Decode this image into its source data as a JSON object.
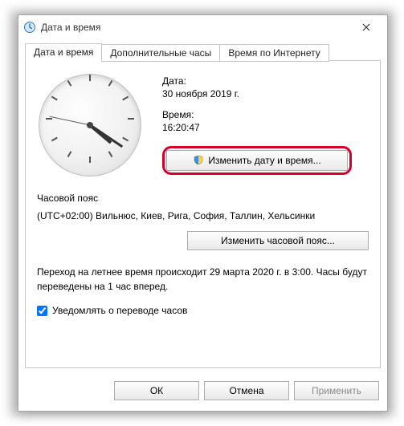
{
  "window": {
    "title": "Дата и время"
  },
  "tabs": [
    {
      "label": "Дата и время",
      "active": true
    },
    {
      "label": "Дополнительные часы",
      "active": false
    },
    {
      "label": "Время по Интернету",
      "active": false
    }
  ],
  "dateSection": {
    "dateLabel": "Дата:",
    "dateValue": "30 ноября 2019 г.",
    "timeLabel": "Время:",
    "timeValue": "16:20:47",
    "changeButton": "Изменить дату и время..."
  },
  "timezone": {
    "heading": "Часовой пояс",
    "value": "(UTC+02:00) Вильнюс, Киев, Рига, София, Таллин, Хельсинки",
    "changeButton": "Изменить часовой пояс..."
  },
  "dst": {
    "text": "Переход на летнее время происходит 29 марта 2020 г. в 3:00. Часы будут переведены на 1 час вперед.",
    "checkboxLabel": "Уведомлять о переводе часов",
    "checked": true
  },
  "footer": {
    "ok": "ОК",
    "cancel": "Отмена",
    "apply": "Применить"
  }
}
